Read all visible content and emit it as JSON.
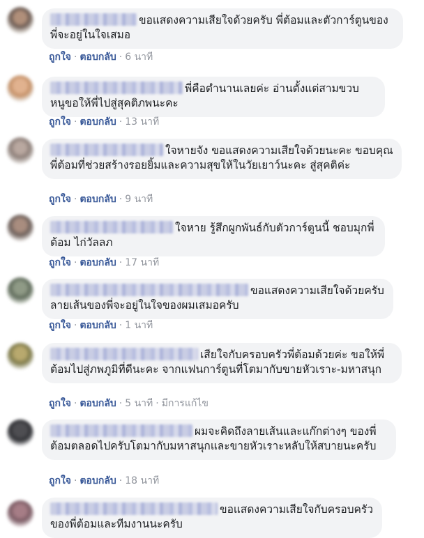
{
  "actions": {
    "like": "ถูกใจ",
    "reply": "ตอบกลับ",
    "separator": "·"
  },
  "comments": [
    {
      "name_width": 124,
      "text": "ขอแสดงความเสียใจด้วยครับ พี่ต้อมและตัวการ์ตูนของพี่จะอยู่ในใจเสมอ",
      "time": "6 นาที",
      "edited": ""
    },
    {
      "name_width": 190,
      "text": "พี่คือตำนานเลยค่ะ อ่านตั้งแต่สามขวบ หนูขอให้พี่ไปสู่สุคติภพนะคะ",
      "time": "13 นาที",
      "edited": ""
    },
    {
      "name_width": 162,
      "text": "ใจหายจัง ขอแสดงความเสียใจด้วยนะคะ ขอบคุณพี่ต้อมที่ช่วยสร้างรอยยิ้มและความสุขให้ในวัยเยาว์นะคะ สู่สุคติค่ะ",
      "time": "9 นาที",
      "edited": ""
    },
    {
      "name_width": 176,
      "text": "ใจหาย รู้สึกผูกพันธ์กับตัวการ์ตูนนี้ ชอบมุกพี่ต้อม ไก่วัลลภ",
      "time": "17 นาที",
      "edited": ""
    },
    {
      "name_width": 284,
      "text": "ขอแสดงความเสียใจด้วยครับ ลายเส้นของพี่จะอยู่ในใจของผมเสมอครับ",
      "time": "1 นาที",
      "edited": ""
    },
    {
      "name_width": 212,
      "text": "เสียใจกับครอบครัวพี่ต้อมด้วยค่ะ ขอให้พี่ต้อมไปสู่ภพภูมิที่ดีนะคะ จากแฟนการ์ตูนที่โตมากับขายหัวเราะ-มหาสนุก",
      "time": "5 นาที",
      "edited": "มีการแก้ไข"
    },
    {
      "name_width": 204,
      "text": "ผมจะคิดถึงลายเส้นและแก๊กต่างๆ ของพี่ต้อมตลอดไปครับโตมากับมหาสนุกและขายหัวเราะหลับให้สบายนะครับ",
      "time": "18 นาที",
      "edited": ""
    },
    {
      "name_width": 240,
      "text": "ขอแสดงความเสียใจกับครอบครัวของพี่ต้อมและทีมงานนะครับ",
      "time": "",
      "edited": ""
    }
  ],
  "colors": {
    "bubble": "#f2f3f5",
    "link": "#385898",
    "meta": "#90949c"
  }
}
